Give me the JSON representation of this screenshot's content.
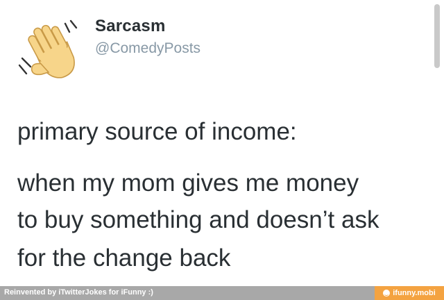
{
  "tweet": {
    "author_name": "Sarcasm",
    "author_handle": "@ComedyPosts",
    "avatar_icon": "waving-hand-icon",
    "lines": [
      "primary source of income:",
      "when my mom gives me money",
      "to buy something and doesn’t ask",
      "for the change back"
    ]
  },
  "footer": {
    "credit": "Reinvented by iTwitterJokes for iFunny :)",
    "brand": "ifunny.mobi",
    "brand_icon": "ifunny-smile-icon",
    "brand_color": "#f4a341",
    "bar_color": "#a8a8a8"
  },
  "colors": {
    "text": "#292f33",
    "handle": "#8899a6",
    "hand_skin": "#f7d58a"
  }
}
